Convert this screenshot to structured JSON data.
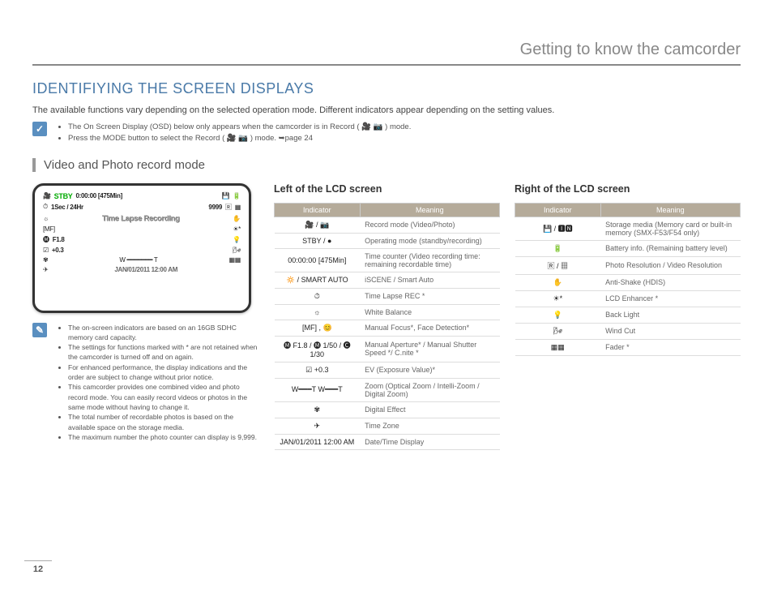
{
  "header": {
    "chapter": "Getting to know the camcorder"
  },
  "title": "IDENTIFIYING THE SCREEN DISPLAYS",
  "intro": "The available functions vary depending on the selected operation mode. Different indicators appear depending on the setting values.",
  "top_notes": [
    "The On Screen Display (OSD) below only appears when the camcorder is in Record ( 🎥 📷 ) mode.",
    "Press the MODE button to select the Record ( 🎥 📷 ) mode. ➥page 24"
  ],
  "subtitle": "Video and Photo record mode",
  "lcd": {
    "stby": "STBY",
    "counter": "0:00:00 [475Min]",
    "sec": "1Sec / 24Hr",
    "nine": "9999",
    "timelapse": "Time Lapse Recording",
    "f": "F1.8",
    "ev": "+0.3",
    "wt": "W ━━━━━━━ T",
    "date": "JAN/01/2011 12:00 AM"
  },
  "side_notes": [
    "The on-screen indicators are based on an 16GB SDHC memory card capacity.",
    "The settings for functions marked with * are not retained when the camcorder is turned off and on again.",
    "For enhanced performance, the display indications and the order are subject to change without prior notice.",
    "This camcorder provides one combined video and photo record mode. You can easily record videos or photos in the same mode without having to change it.",
    "The total number of recordable photos is based on the available space on the storage media.",
    "The maximum number the photo counter can display is 9,999."
  ],
  "left_table": {
    "title": "Left of the LCD screen",
    "h1": "Indicator",
    "h2": "Meaning",
    "rows": [
      {
        "ind": "🎥 / 📷",
        "mean": "Record mode (Video/Photo)"
      },
      {
        "ind": "STBY / ●",
        "mean": "Operating mode (standby/recording)"
      },
      {
        "ind": "00:00:00 [475Min]",
        "mean": "Time counter (Video recording time: remaining recordable time)"
      },
      {
        "ind": "🔅 / SMART AUTO",
        "mean": "iSCENE / Smart Auto"
      },
      {
        "ind": "⏱",
        "mean": "Time Lapse REC *"
      },
      {
        "ind": "☼",
        "mean": "White Balance"
      },
      {
        "ind": "[MF] , 😊",
        "mean": "Manual Focus*, Face Detection*"
      },
      {
        "ind": "🅜 F1.8 / 🅜 1/50 / 🅒 1/30",
        "mean": "Manual Aperture* / Manual Shutter Speed */ C.nite *"
      },
      {
        "ind": "☑ +0.3",
        "mean": "EV (Exposure Value)*"
      },
      {
        "ind": "W━━━T  W━━━T",
        "mean": "Zoom (Optical Zoom / Intelli-Zoom / Digital Zoom)"
      },
      {
        "ind": "✾",
        "mean": "Digital Effect"
      },
      {
        "ind": "✈",
        "mean": "Time Zone"
      },
      {
        "ind": "JAN/01/2011 12:00 AM",
        "mean": "Date/Time Display"
      }
    ]
  },
  "right_table": {
    "title": "Right of the LCD screen",
    "h1": "Indicator",
    "h2": "Meaning",
    "rows": [
      {
        "ind": "💾 / 🅸🅽",
        "mean": "Storage media (Memory card or built-in memory (SMX-F53/F54 only)"
      },
      {
        "ind": "🔋",
        "mean": "Battery info. (Remaining battery level)"
      },
      {
        "ind": "🅁 / ▦",
        "mean": "Photo Resolution / Video Resolution"
      },
      {
        "ind": "✋",
        "mean": "Anti-Shake (HDIS)"
      },
      {
        "ind": "☀*",
        "mean": "LCD Enhancer *"
      },
      {
        "ind": "💡",
        "mean": "Back Light"
      },
      {
        "ind": "🌬",
        "mean": "Wind Cut"
      },
      {
        "ind": "▦▦",
        "mean": "Fader *"
      }
    ]
  },
  "page_num": "12"
}
